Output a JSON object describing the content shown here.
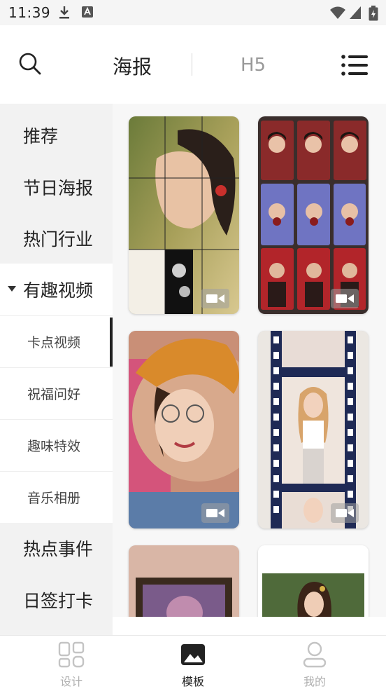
{
  "status_bar": {
    "time": "11:39",
    "icons": [
      "download-icon",
      "app-notification-icon",
      "wifi-icon",
      "signal-icon",
      "battery-charging-icon"
    ]
  },
  "header": {
    "search_icon": "search-icon",
    "tabs": [
      {
        "label": "海报",
        "active": true
      },
      {
        "label": "H5",
        "active": false
      }
    ],
    "menu_icon": "menu-icon"
  },
  "sidebar": {
    "items": [
      {
        "label": "推荐",
        "level": "main"
      },
      {
        "label": "节日海报",
        "level": "main"
      },
      {
        "label": "热门行业",
        "level": "main"
      },
      {
        "label": "有趣视频",
        "level": "main",
        "expanded": true
      },
      {
        "label": "卡点视频",
        "level": "sub",
        "active": true
      },
      {
        "label": "祝福问好",
        "level": "sub"
      },
      {
        "label": "趣味特效",
        "level": "sub"
      },
      {
        "label": "音乐相册",
        "level": "sub"
      },
      {
        "label": "热点事件",
        "level": "main"
      },
      {
        "label": "日签打卡",
        "level": "main"
      }
    ]
  },
  "templates": [
    {
      "name": "portrait-grid-split",
      "video": true
    },
    {
      "name": "nine-grid-collage",
      "video": true
    },
    {
      "name": "circle-portrait-pink",
      "video": true
    },
    {
      "name": "film-strip-portrait",
      "video": true
    },
    {
      "name": "framed-portrait",
      "video": false
    },
    {
      "name": "woman-portrait-green",
      "video": false
    }
  ],
  "bottom_nav": {
    "items": [
      {
        "label": "设计",
        "icon": "grid-design-icon",
        "active": false
      },
      {
        "label": "模板",
        "icon": "template-image-icon",
        "active": true
      },
      {
        "label": "我的",
        "icon": "profile-icon",
        "active": false
      }
    ]
  },
  "colors": {
    "accent": "#222222",
    "sidebar_bg": "#f2f2f2",
    "inactive_text": "#999999"
  }
}
